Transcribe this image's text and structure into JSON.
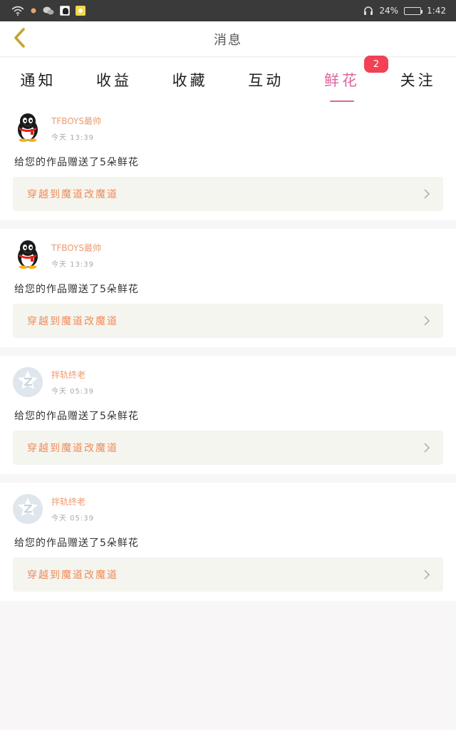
{
  "status_bar": {
    "right_text": "24%",
    "time": "1:42"
  },
  "header": {
    "title": "消息"
  },
  "tabs": [
    {
      "label": "通知"
    },
    {
      "label": "收益"
    },
    {
      "label": "收藏"
    },
    {
      "label": "互动"
    },
    {
      "label": "鲜花",
      "badge": "2"
    },
    {
      "label": "关注"
    }
  ],
  "messages": [
    {
      "username": "TFBOYS最帅",
      "time": "今天 13:39",
      "text": "给您的作品赠送了5朵鲜花",
      "work_title": "穿越到魔道改魔道"
    },
    {
      "username": "TFBOYS最帅",
      "time": "今天 13:39",
      "text": "给您的作品赠送了5朵鲜花",
      "work_title": "穿越到魔道改魔道"
    },
    {
      "username": "拌轨终老",
      "time": "今天 05:39",
      "text": "给您的作品赠送了5朵鲜花",
      "work_title": "穿越到魔道改魔道"
    },
    {
      "username": "拌轨终老",
      "time": "今天 05:39",
      "text": "给您的作品赠送了5朵鲜花",
      "work_title": "穿越到魔道改魔道"
    }
  ],
  "colors": {
    "accent_pink": "#e0649c",
    "badge_red": "#f24055",
    "username_orange": "#ee9a6e",
    "link_orange": "#ef8a58"
  }
}
